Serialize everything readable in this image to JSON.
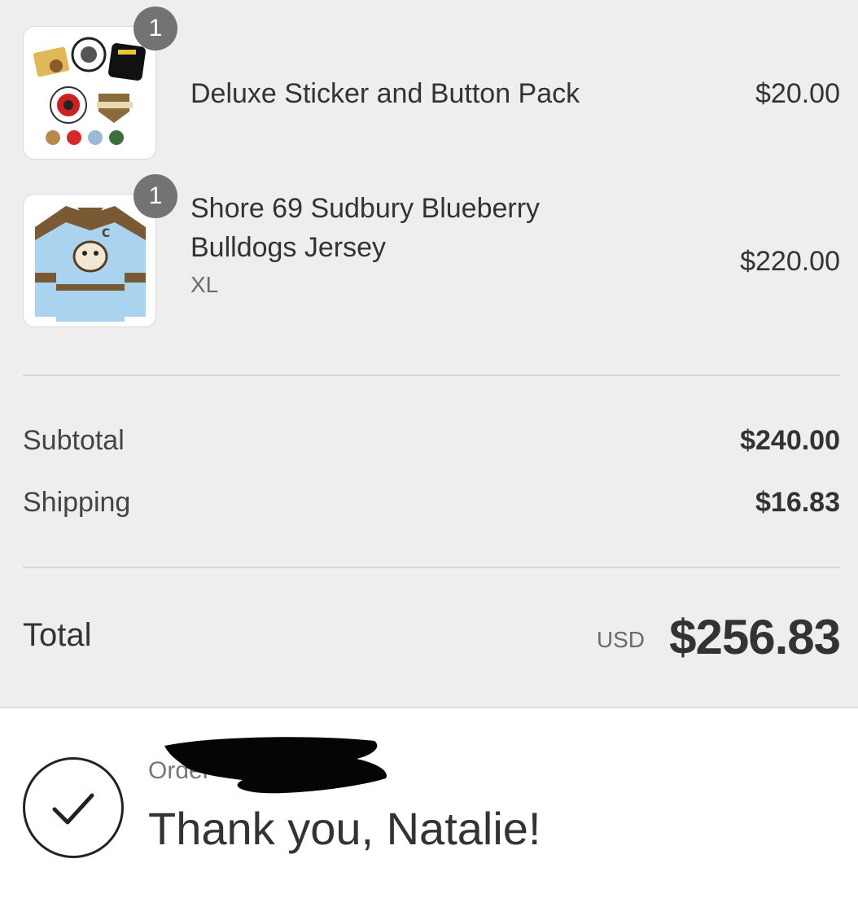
{
  "items": [
    {
      "name": "Deluxe Sticker and Button Pack",
      "quantity": "1",
      "price": "$20.00"
    },
    {
      "name_line1": "Shore 69 Sudbury Blueberry",
      "name_line2": "Bulldogs Jersey",
      "variant": "XL",
      "quantity": "1",
      "price": "$220.00"
    }
  ],
  "summary": {
    "subtotal_label": "Subtotal",
    "subtotal_value": "$240.00",
    "shipping_label": "Shipping",
    "shipping_value": "$16.83",
    "total_label": "Total",
    "currency": "USD",
    "total_value": "$256.83"
  },
  "confirmation": {
    "order_label": "Order",
    "thank_you": "Thank you, Natalie!"
  },
  "colors": {
    "summary_background": "#eeeeee",
    "badge": "#737373",
    "jersey_blue": "#a9d3ee",
    "jersey_brown": "#7a5a34"
  }
}
